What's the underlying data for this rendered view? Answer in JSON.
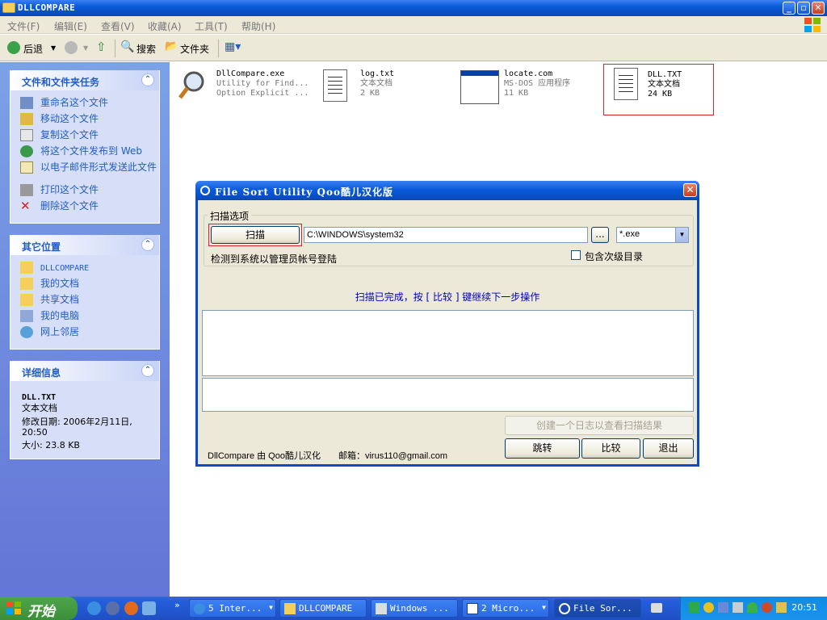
{
  "window": {
    "title": "DLLCOMPARE"
  },
  "menu": [
    "文件(F)",
    "编辑(E)",
    "查看(V)",
    "收藏(A)",
    "工具(T)",
    "帮助(H)"
  ],
  "toolbar": {
    "back": "后退",
    "search": "搜索",
    "folders": "文件夹"
  },
  "tasks_panel": {
    "title": "文件和文件夹任务",
    "items": [
      "重命名这个文件",
      "移动这个文件",
      "复制这个文件",
      "将这个文件发布到 Web",
      "以电子邮件形式发送此文件",
      "打印这个文件",
      "删除这个文件"
    ]
  },
  "places_panel": {
    "title": "其它位置",
    "items": [
      "DLLCOMPARE",
      "我的文档",
      "共享文档",
      "我的电脑",
      "网上邻居"
    ]
  },
  "details_panel": {
    "title": "详细信息",
    "name": "DLL.TXT",
    "type": "文本文档",
    "modified": "修改日期: 2006年2月11日, 20:50",
    "size": "大小: 23.8 KB"
  },
  "files": [
    {
      "name": "DllCompare.exe",
      "line2": "Utility for Find...",
      "line3": "Option Explicit ..."
    },
    {
      "name": "log.txt",
      "line2": "文本文档",
      "line3": "2 KB"
    },
    {
      "name": "locate.com",
      "line2": "MS-DOS 应用程序",
      "line3": "11 KB"
    },
    {
      "name": "DLL.TXT",
      "line2": "文本文档",
      "line3": "24 KB"
    }
  ],
  "dialog": {
    "title": "File Sort Utility Qoo酷儿汉化版",
    "group_label": "扫描选项",
    "scan_button": "扫描",
    "path_value": "C:\\WINDOWS\\system32",
    "browse_button": "...",
    "filter_value": "*.exe",
    "admin_note": "检测到系统以管理员帐号登陆",
    "subdir_label": "包含次级目录",
    "status_text": "扫描已完成，按 [ 比较 ] 键继续下一步操作",
    "log_button": "创建一个日志以查看扫描结果",
    "goto_button": "跳转",
    "compare_button": "比较",
    "exit_button": "退出",
    "footer": "DllCompare 由 Qoo酷儿汉化　　邮箱：virus110@gmail.com"
  },
  "taskbar": {
    "start": "开始",
    "tasks": [
      "5 Inter...",
      "DLLCOMPARE",
      "Windows ...",
      "2 Micro...",
      "File Sor..."
    ],
    "clock": "20:51"
  }
}
